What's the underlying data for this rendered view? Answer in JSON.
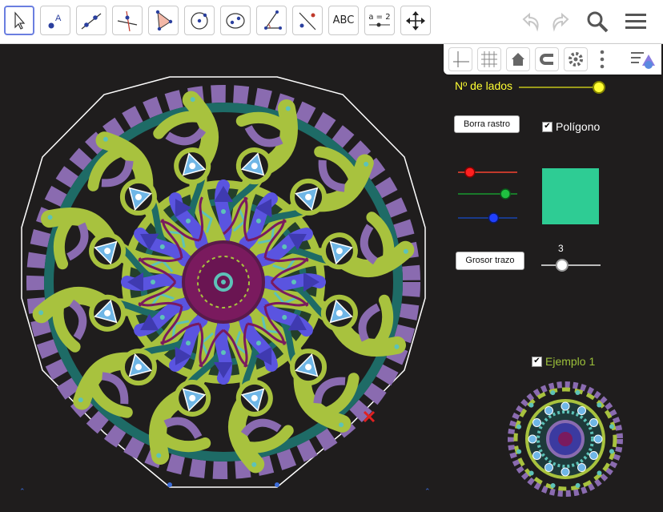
{
  "toolbar": {
    "tools": [
      {
        "name": "move-tool",
        "icon": "arrow-cursor-icon"
      },
      {
        "name": "point-tool",
        "icon": "point-icon",
        "glyph": "A"
      },
      {
        "name": "line-tool",
        "icon": "line-icon"
      },
      {
        "name": "perpendicular-line-tool",
        "icon": "perpendicular-icon"
      },
      {
        "name": "polygon-tool",
        "icon": "polygon-icon"
      },
      {
        "name": "circle-tool",
        "icon": "circle-icon"
      },
      {
        "name": "ellipse-tool",
        "icon": "ellipse-icon"
      },
      {
        "name": "angle-tool",
        "icon": "angle-icon"
      },
      {
        "name": "reflect-tool",
        "icon": "reflect-icon"
      },
      {
        "name": "text-tool",
        "icon": "text-icon",
        "label": "ABC"
      },
      {
        "name": "slider-tool",
        "icon": "slider-icon",
        "label": "a = 2"
      },
      {
        "name": "move-view-tool",
        "icon": "move-arrows-icon"
      }
    ]
  },
  "controls": {
    "sides_label": "Nº de lados",
    "clear_trace_label": "Borra rastro",
    "polygon_label": "Polígono",
    "polygon_checked": true,
    "stroke_width_label": "Grosor trazo",
    "stroke_width_value": "3",
    "stroke_width_fraction": 0.35,
    "sides_fraction": 1.0,
    "example_label": "Ejemplo 1",
    "example_checked": true,
    "red_fraction": 0.2,
    "green_fraction": 0.8,
    "blue_fraction": 0.6,
    "color_preview": "#2ecc94"
  },
  "colors": {
    "background": "#1f1d1d",
    "lime": "#a8c23e",
    "teal": "#1e6b66",
    "purple": "#8a6bb0",
    "violet": "#5a54e0",
    "maroon": "#7a1a5e",
    "sky": "#6fb6e6",
    "label_yellow": "#ffff33",
    "example_green": "#9cc03a"
  }
}
